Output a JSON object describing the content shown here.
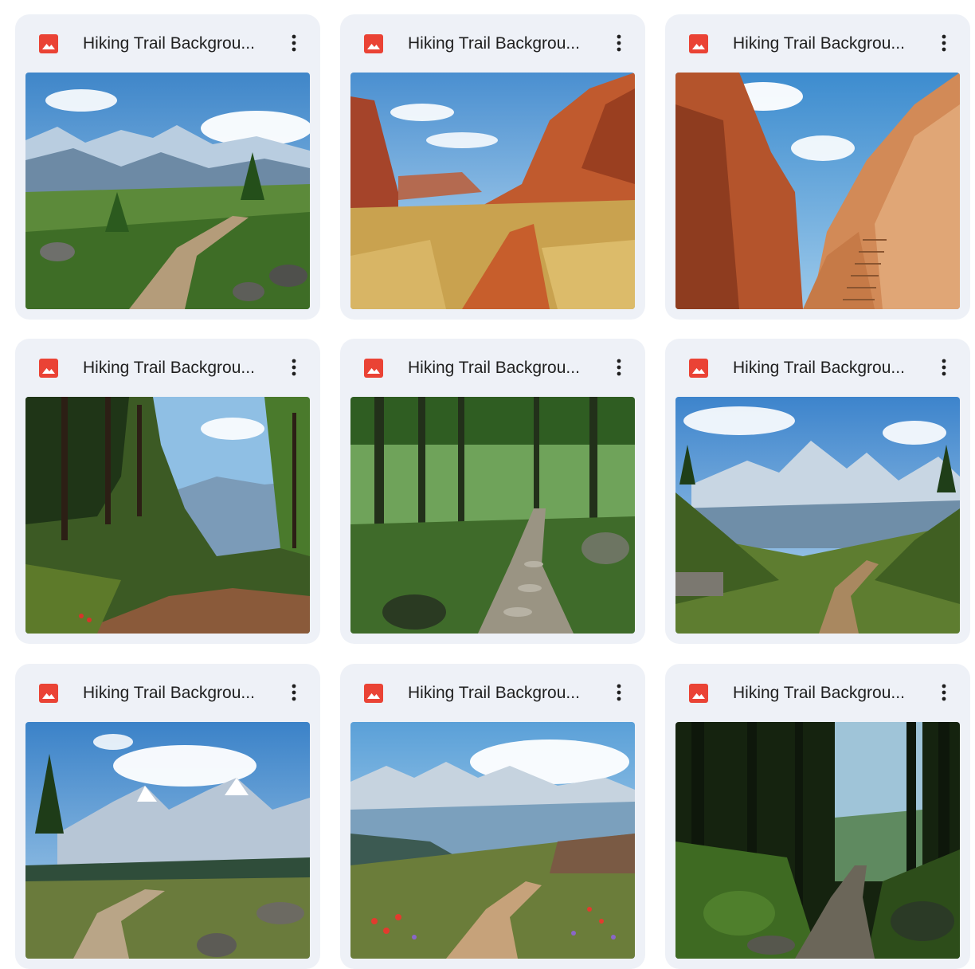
{
  "files": [
    {
      "name": "Hiking Trail Backgrou...",
      "icon": "image-file-icon",
      "scene": "alpine-meadow-trail"
    },
    {
      "name": "Hiking Trail Backgrou...",
      "icon": "image-file-icon",
      "scene": "red-desert-canyon-trail"
    },
    {
      "name": "Hiking Trail Backgrou...",
      "icon": "image-file-icon",
      "scene": "sandstone-canyon-steps"
    },
    {
      "name": "Hiking Trail Backgrou...",
      "icon": "image-file-icon",
      "scene": "pine-forest-hillside-trail"
    },
    {
      "name": "Hiking Trail Backgrou...",
      "icon": "image-file-icon",
      "scene": "forest-stone-path"
    },
    {
      "name": "Hiking Trail Backgrou...",
      "icon": "image-file-icon",
      "scene": "mountain-valley-trail"
    },
    {
      "name": "Hiking Trail Backgrou...",
      "icon": "image-file-icon",
      "scene": "snowy-peaks-trail"
    },
    {
      "name": "Hiking Trail Backgrou...",
      "icon": "image-file-icon",
      "scene": "wildflower-mountain-trail"
    },
    {
      "name": "Hiking Trail Backgrou...",
      "icon": "image-file-icon",
      "scene": "deep-forest-trail"
    }
  ],
  "colors": {
    "card_bg": "#eef1f7",
    "icon_red": "#ea4335",
    "text": "#1f1f1f"
  }
}
